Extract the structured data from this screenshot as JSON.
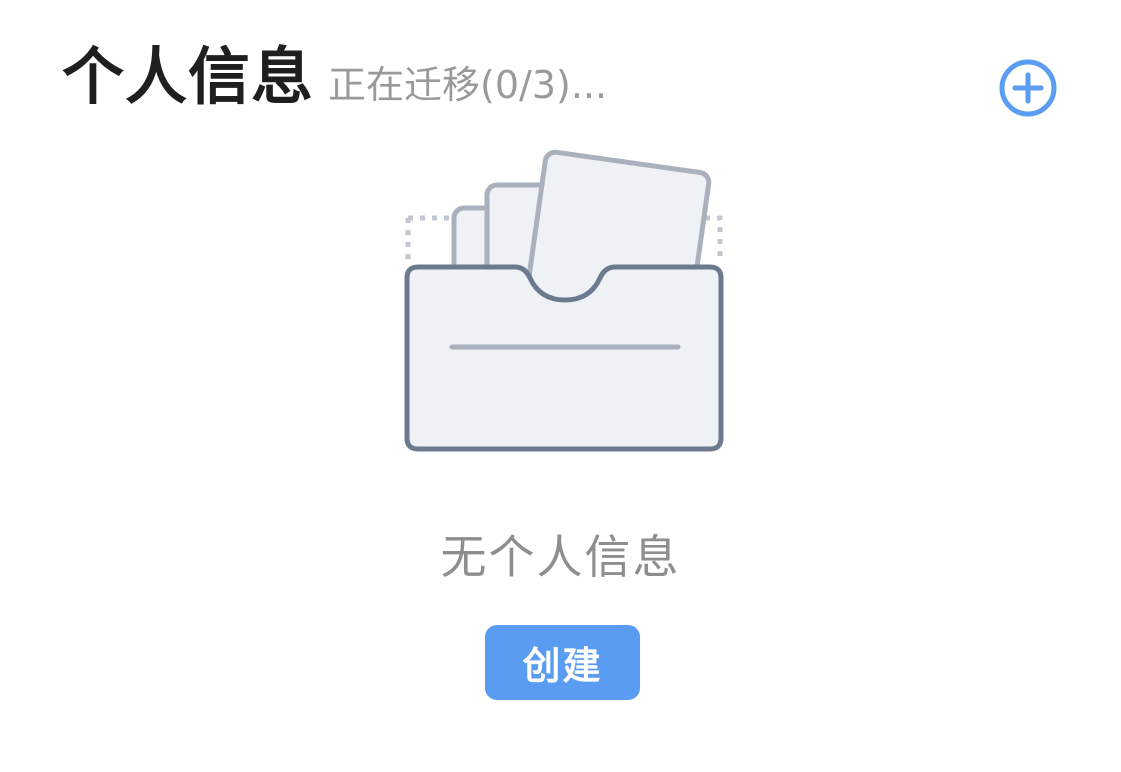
{
  "header": {
    "title": "个人信息",
    "status": "正在迁移(0/3)..."
  },
  "actions": {
    "add_icon": "plus-circle-icon"
  },
  "empty_state": {
    "illustration_icon": "empty-folder-icon",
    "message": "无个人信息",
    "create_label": "创建"
  },
  "colors": {
    "accent": "#5a9cf2",
    "title": "#1f1f1f",
    "muted": "#9a9a9a",
    "illustration_stroke": "#6b7a8f",
    "illustration_fill": "#eef1f5"
  }
}
